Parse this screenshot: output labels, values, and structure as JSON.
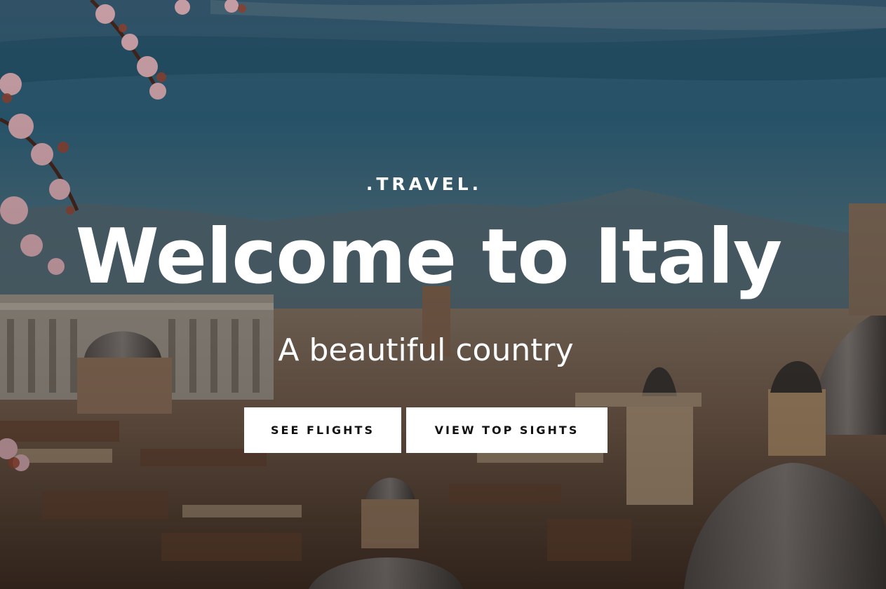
{
  "hero": {
    "eyebrow": ".TRAVEL.",
    "title": "Welcome to Italy",
    "subtitle": "A beautiful country",
    "background_image": "rome-skyline-photo"
  },
  "actions": {
    "see_flights_label": "SEE FLIGHTS",
    "view_top_sights_label": "VIEW TOP SIGHTS"
  },
  "colors": {
    "button_background": "#ffffff",
    "button_text": "#111111",
    "headline_text": "#ffffff"
  }
}
